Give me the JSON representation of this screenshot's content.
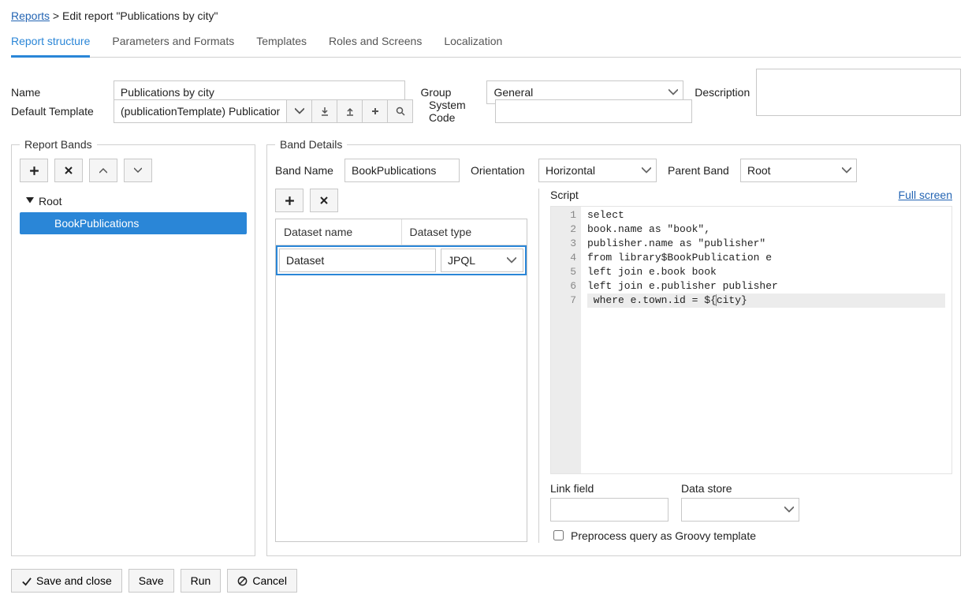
{
  "breadcrumb": {
    "link": "Reports",
    "trail": "> Edit report \"Publications by city\""
  },
  "tabs": [
    "Report structure",
    "Parameters and Formats",
    "Templates",
    "Roles and Screens",
    "Localization"
  ],
  "form": {
    "name_label": "Name",
    "name_value": "Publications by city",
    "group_label": "Group",
    "group_value": "General",
    "description_label": "Description",
    "description_value": "",
    "default_template_label": "Default Template",
    "default_template_value": "(publicationTemplate) Publication",
    "system_code_label": "System Code",
    "system_code_value": ""
  },
  "report_bands": {
    "legend": "Report Bands",
    "root": "Root",
    "child": "BookPublications"
  },
  "band_details": {
    "legend": "Band Details",
    "band_name_label": "Band Name",
    "band_name_value": "BookPublications",
    "orientation_label": "Orientation",
    "orientation_value": "Horizontal",
    "parent_band_label": "Parent Band",
    "parent_band_value": "Root",
    "dataset_name_header": "Dataset name",
    "dataset_type_header": "Dataset type",
    "dataset_name_value": "Dataset",
    "dataset_type_value": "JPQL",
    "script_label": "Script",
    "full_screen_label": "Full screen",
    "script_lines": [
      "select",
      "book.name as \"book\",",
      "publisher.name as \"publisher\"",
      "from library$BookPublication e",
      "left join e.book book",
      "left join e.publisher publisher",
      " where e.town.id = ${city}"
    ],
    "link_field_label": "Link field",
    "link_field_value": "",
    "data_store_label": "Data store",
    "data_store_value": "",
    "preprocess_label": "Preprocess query as Groovy template"
  },
  "footer": {
    "save_close": "Save and close",
    "save": "Save",
    "run": "Run",
    "cancel": "Cancel"
  }
}
